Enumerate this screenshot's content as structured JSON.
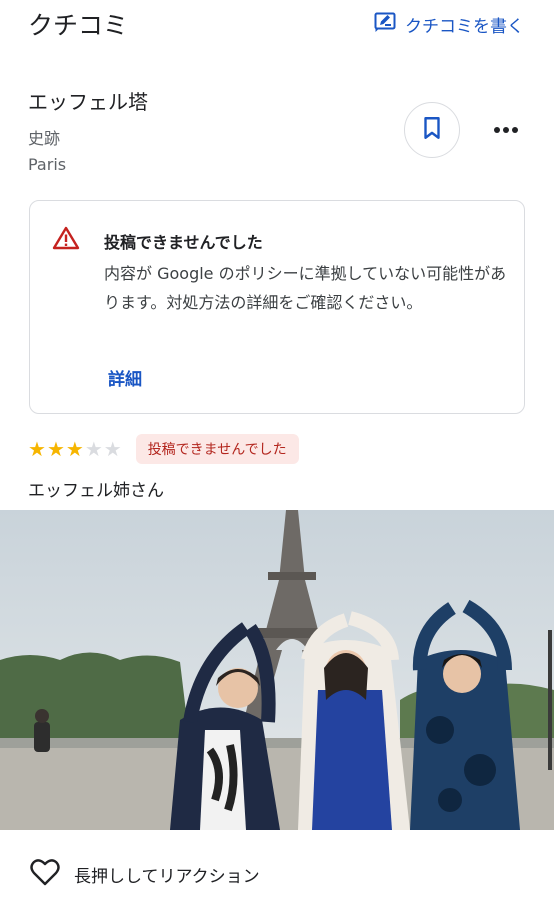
{
  "header": {
    "title": "クチコミ",
    "write_review_label": "クチコミを書く"
  },
  "place": {
    "name": "エッフェル塔",
    "type": "史跡",
    "city": "Paris"
  },
  "warning": {
    "title": "投稿できませんでした",
    "body": "内容が Google のポリシーに準拠していない可能性があります。対処方法の詳細をご確認ください。",
    "link_label": "詳細"
  },
  "review": {
    "rating": 3,
    "max_rating": 5,
    "status_badge": "投稿できませんでした",
    "reviewer_name": "エッフェル姉さん"
  },
  "reaction": {
    "label": "長押ししてリアクション"
  },
  "colors": {
    "accent": "#1a56c4",
    "star": "#f6b500",
    "warning_icon": "#c5221f",
    "badge_bg": "#fce8e6",
    "badge_text": "#b3261e"
  },
  "icons": {
    "write": "edit-review-icon",
    "save": "bookmark-icon",
    "more": "more-horizontal-icon",
    "warning": "warning-triangle-icon",
    "reaction": "heart-outline-icon"
  }
}
